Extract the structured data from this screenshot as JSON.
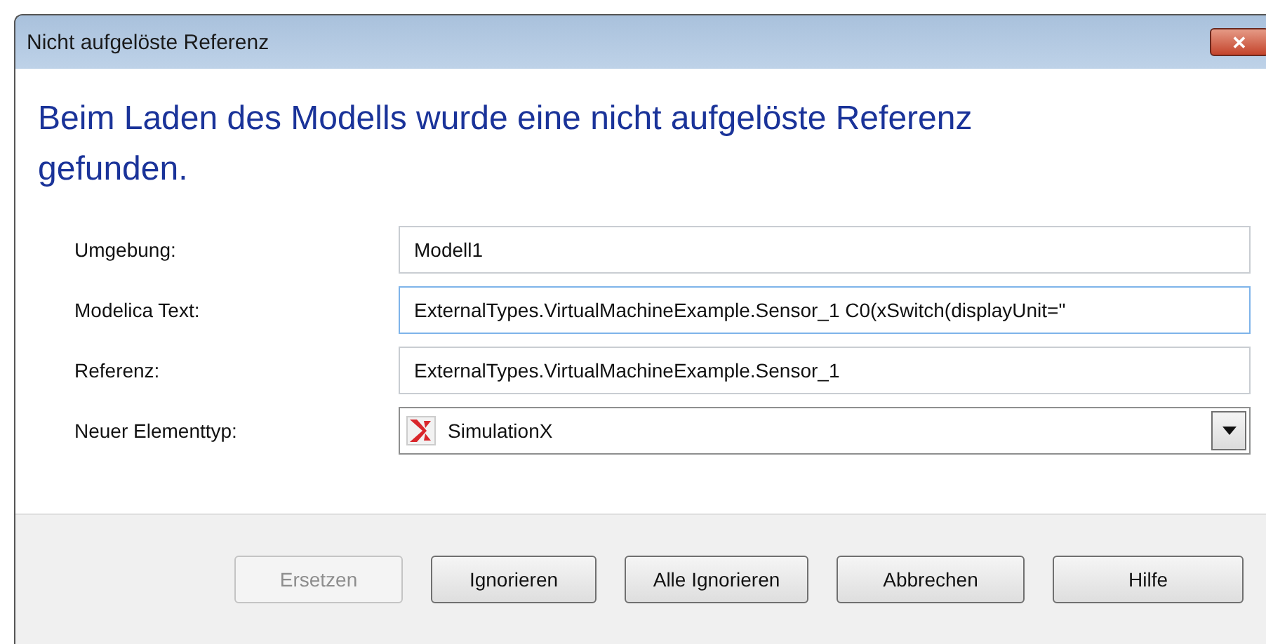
{
  "window": {
    "title": "Nicht aufgelöste Referenz",
    "close_label": "✕"
  },
  "heading": "Beim Laden des Modells wurde eine nicht aufgelöste Referenz gefunden.",
  "fields": [
    {
      "kind": "text",
      "label": "Umgebung:",
      "value": "Modell1",
      "focused": false
    },
    {
      "kind": "text",
      "label": "Modelica Text:",
      "value": "ExternalTypes.VirtualMachineExample.Sensor_1 C0(xSwitch(displayUnit=\"",
      "focused": true
    },
    {
      "kind": "text",
      "label": "Referenz:",
      "value": "ExternalTypes.VirtualMachineExample.Sensor_1",
      "focused": false
    },
    {
      "kind": "select",
      "label": "Neuer Elementtyp:",
      "value": "SimulationX"
    }
  ],
  "buttons": [
    {
      "label": "Ersetzen",
      "disabled": true
    },
    {
      "label": "Ignorieren",
      "disabled": false
    },
    {
      "label": "Alle Ignorieren",
      "disabled": false
    },
    {
      "label": "Abbrechen",
      "disabled": false
    },
    {
      "label": "Hilfe",
      "disabled": false
    }
  ]
}
